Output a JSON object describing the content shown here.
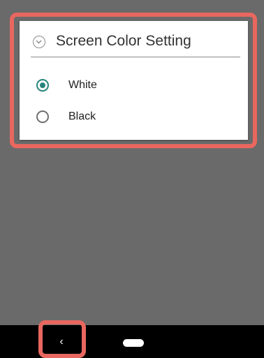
{
  "dialog": {
    "title": "Screen Color Setting",
    "title_icon": "chevron-down-circle-icon",
    "options": [
      {
        "label": "White",
        "selected": true
      },
      {
        "label": "Black",
        "selected": false
      }
    ]
  },
  "nav": {
    "back_symbol": "‹",
    "back_icon": "back-icon",
    "home_icon": "home-pill-icon"
  },
  "colors": {
    "background": "#6a6a6a",
    "highlight": "#e8675f",
    "accent": "#26847b",
    "nav_bar": "#000000"
  }
}
